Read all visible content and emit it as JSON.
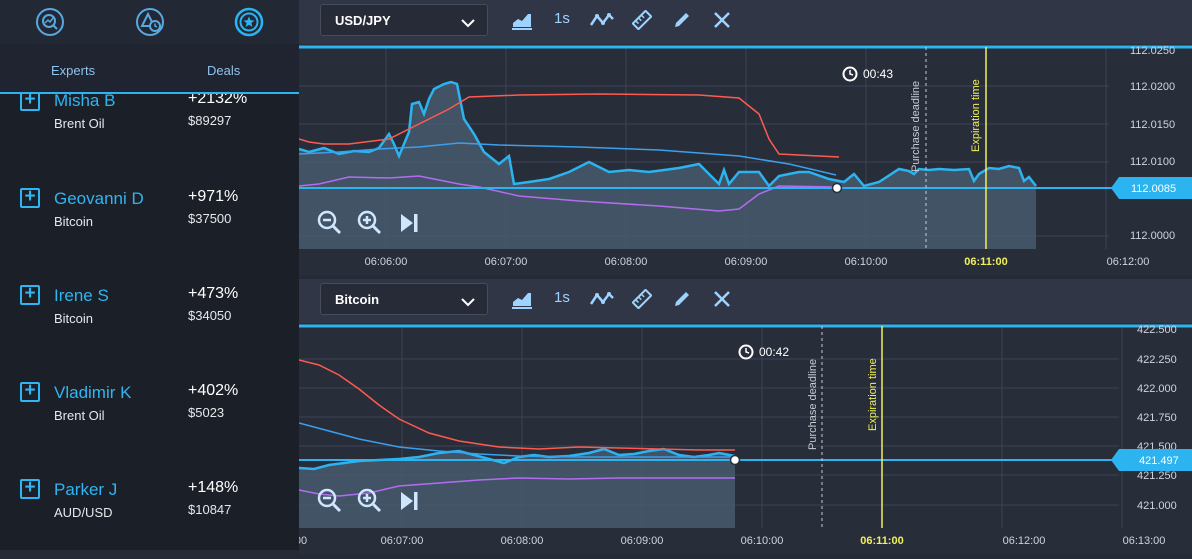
{
  "sidebar": {
    "icons": [
      "chart-search-icon",
      "triangle-clock-icon",
      "star-badge-icon"
    ],
    "tabs": {
      "experts": "Experts",
      "deals": "Deals"
    },
    "experts": [
      {
        "name": "Misha B",
        "asset": "Brent Oil",
        "pct": "+2132%",
        "amount": "$89297"
      },
      {
        "name": "Geovanni D",
        "asset": "Bitcoin",
        "pct": "+971%",
        "amount": "$37500"
      },
      {
        "name": "Irene S",
        "asset": "Bitcoin",
        "pct": "+473%",
        "amount": "$34050"
      },
      {
        "name": "Vladimir K",
        "asset": "Brent Oil",
        "pct": "+402%",
        "amount": "$5023"
      },
      {
        "name": "Parker J",
        "asset": "AUD/USD",
        "pct": "+148%",
        "amount": "$10847"
      }
    ]
  },
  "charts": [
    {
      "asset": "USD/JPY",
      "interval": "1s",
      "timer": "00:43",
      "purchase_deadline": "Purchase deadline",
      "expiration_time": "Expiration time",
      "current_price": "112.0085",
      "y_labels": [
        "112.0250",
        "112.0200",
        "112.0150",
        "112.0100",
        "112.0000"
      ],
      "x_labels": [
        "06:06:00",
        "06:07:00",
        "06:08:00",
        "06:09:00",
        "06:10:00",
        "06:11:00",
        "06:12:00"
      ],
      "expiration_label": "06:11:00"
    },
    {
      "asset": "Bitcoin",
      "interval": "1s",
      "timer": "00:42",
      "purchase_deadline": "Purchase deadline",
      "expiration_time": "Expiration time",
      "current_price": "421.497",
      "y_labels": [
        "422.500",
        "422.250",
        "422.000",
        "421.750",
        "421.500",
        "421.250",
        "421.000"
      ],
      "x_labels": [
        "00",
        "06:07:00",
        "06:08:00",
        "06:09:00",
        "06:10:00",
        "06:11:00",
        "06:12:00",
        "06:13:00"
      ],
      "expiration_label": "06:11:00"
    }
  ],
  "colors": {
    "accent": "#2bb4f0",
    "upper_band": "#ff5a4f",
    "lower_band": "#b36cf0",
    "middle_band": "#3aa0ee",
    "expiration": "#f0f05a"
  }
}
